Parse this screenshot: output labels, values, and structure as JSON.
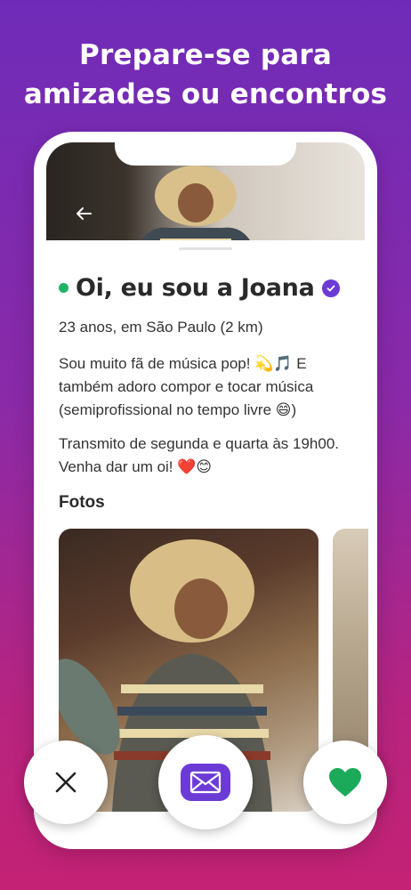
{
  "headline": {
    "line1": "Prepare-se para",
    "line2": "amizades ou encontros"
  },
  "profile": {
    "back_icon": "arrow-left-icon",
    "name": "Oi, eu sou a Joana",
    "online": true,
    "verified": true,
    "location": "23 anos, em São Paulo (2 km)",
    "bio": [
      "Sou muito fã de música pop! 💫🎵 E também adoro compor e tocar música (semiprofissional no tempo livre 😄)",
      "Transmito de segunda e quarta às 19h00. Venha dar um oi! ❤️😊"
    ],
    "photos_title": "Fotos"
  },
  "actions": {
    "close_icon": "close-icon",
    "message_icon": "envelope-icon",
    "like_icon": "heart-icon"
  },
  "colors": {
    "accent": "#6c3bd6",
    "online": "#1fb36a",
    "like": "#1aaa5a",
    "bg_top": "#6f2bb8",
    "bg_bottom": "#c42274"
  }
}
